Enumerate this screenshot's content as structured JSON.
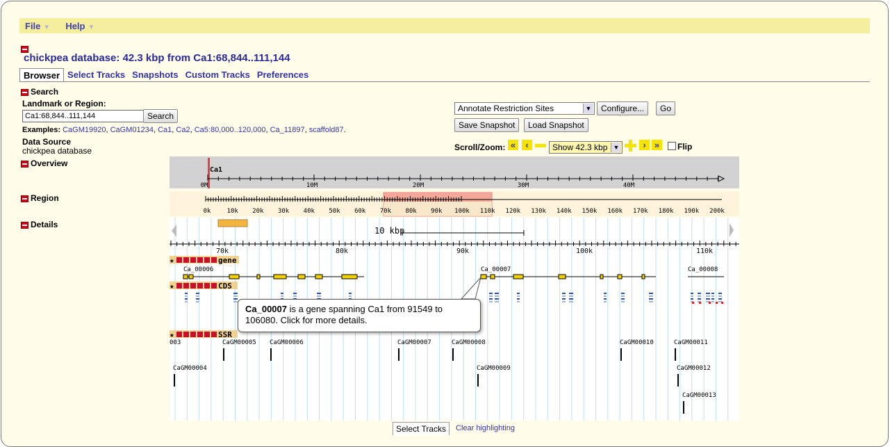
{
  "menu": {
    "file": "File",
    "help": "Help"
  },
  "page_title": "chickpea database: 42.3 kbp from Ca1:68,844..111,144",
  "tabs": [
    "Browser",
    "Select Tracks",
    "Snapshots",
    "Custom Tracks",
    "Preferences"
  ],
  "search": {
    "section": "Search",
    "landmark_label": "Landmark or Region:",
    "value": "Ca1:68,844..111,144",
    "button": "Search",
    "examples_label": "Examples:",
    "examples": [
      "CaGM19920",
      "CaGM01234",
      "Ca1",
      "Ca2",
      "Ca5:80,000..120,000",
      "Ca_11897",
      "scaffold87"
    ],
    "data_source_label": "Data Source",
    "data_source": "chickpea database"
  },
  "tools": {
    "plugin_select": "Annotate Restriction Sites",
    "configure": "Configure...",
    "go": "Go",
    "save_snapshot": "Save Snapshot",
    "load_snapshot": "Load Snapshot",
    "scroll_zoom": "Scroll/Zoom:",
    "zoom_select": "Show 42.3 kbp",
    "flip": "Flip"
  },
  "sections": {
    "overview": "Overview",
    "region": "Region",
    "details": "Details"
  },
  "overview": {
    "chrom": "Ca1",
    "ticks": [
      "0M",
      "10M",
      "20M",
      "30M",
      "40M"
    ]
  },
  "region": {
    "ticks": [
      "0k",
      "10k",
      "20k",
      "30k",
      "40k",
      "50k",
      "60k",
      "70k",
      "80k",
      "90k",
      "100k",
      "110k",
      "120k",
      "130k",
      "140k",
      "150k",
      "160k",
      "170k",
      "180k",
      "190k",
      "200k"
    ]
  },
  "details": {
    "scale": "10 kbp",
    "ticks": [
      "70k",
      "80k",
      "90k",
      "100k",
      "110k"
    ],
    "tracks": {
      "gene": "gene",
      "cds": "CDS",
      "ssr": "SSR"
    },
    "genes": [
      "Ca_00006",
      "Ca_00007",
      "Ca_00008"
    ],
    "ssr": [
      "003",
      "CaGM00005",
      "CaGM00006",
      "CaGM00007",
      "CaGM00008",
      "CaGM00010",
      "CaGM00011",
      "CaGM00004",
      "CaGM00009",
      "CaGM00012",
      "CaGM00013"
    ]
  },
  "tooltip": {
    "gene": "Ca_00007",
    "text": " is a gene spanning Ca1 from 91549 to 106080. Click for more details."
  },
  "footer": {
    "select_tracks": "Select Tracks",
    "clear": "Clear highlighting"
  }
}
